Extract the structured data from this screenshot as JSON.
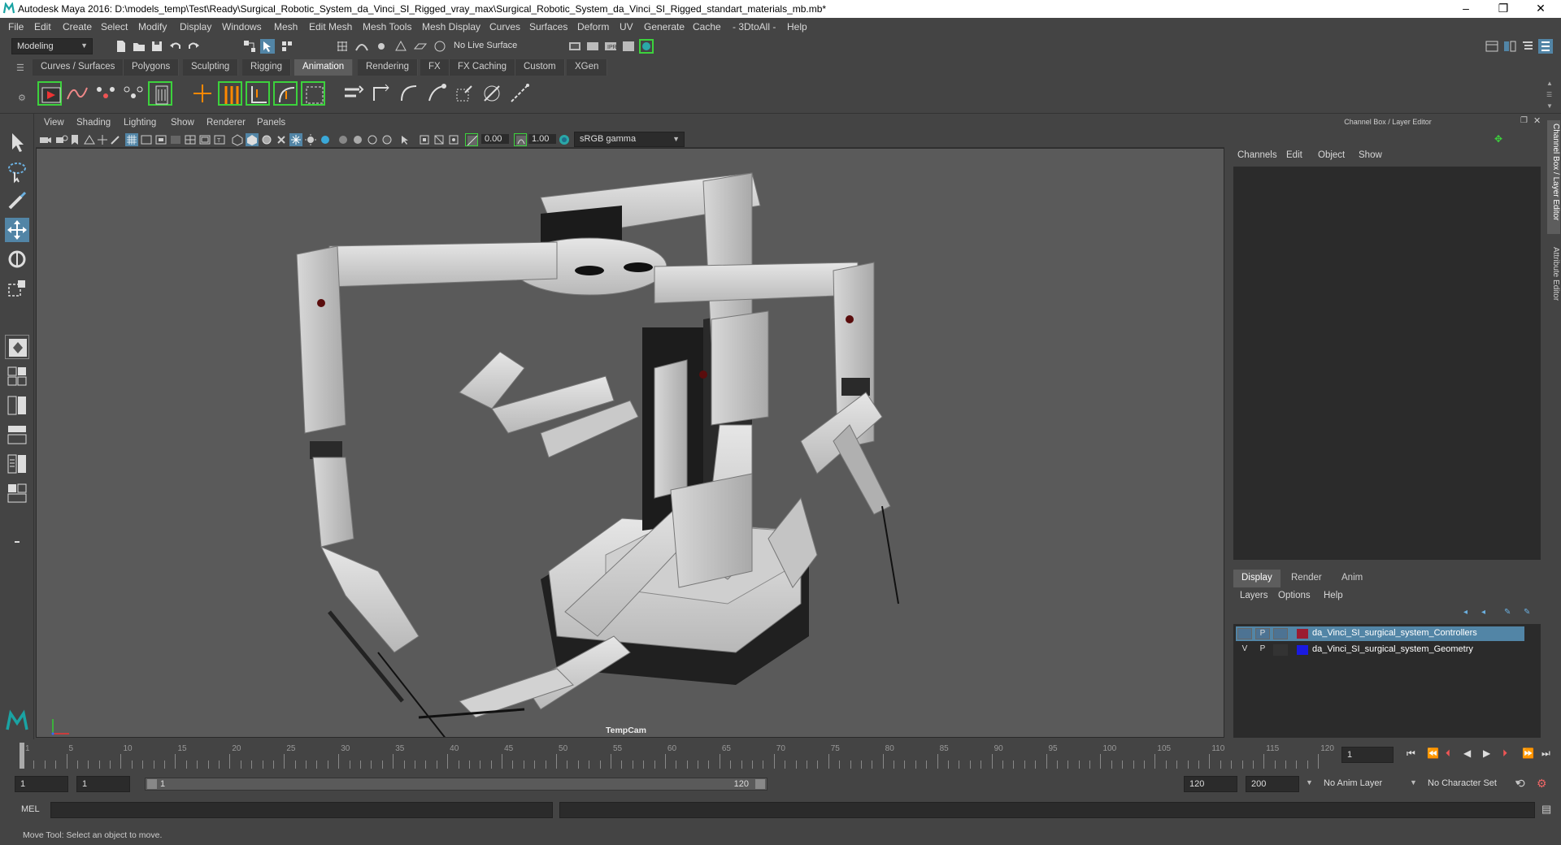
{
  "window": {
    "title": "Autodesk Maya 2016: D:\\models_temp\\Test\\Ready\\Surgical_Robotic_System_da_Vinci_SI_Rigged_vray_max\\Surgical_Robotic_System_da_Vinci_SI_Rigged_standart_materials_mb.mb*",
    "minimize": "–",
    "restore": "❐",
    "close": "✕"
  },
  "menubar": [
    "File",
    "Edit",
    "Create",
    "Select",
    "Modify",
    "Display",
    "Windows",
    "Mesh",
    "Edit Mesh",
    "Mesh Tools",
    "Mesh Display",
    "Curves",
    "Surfaces",
    "Deform",
    "UV",
    "Generate",
    "Cache",
    "- 3DtoAll -",
    "Help"
  ],
  "statusline": {
    "mode": "Modeling",
    "live_surface": "No Live Surface"
  },
  "shelf_tabs": [
    "Curves / Surfaces",
    "Polygons",
    "Sculpting",
    "Rigging",
    "Animation",
    "Rendering",
    "FX",
    "FX Caching",
    "Custom",
    "XGen"
  ],
  "active_shelf_tab": "Animation",
  "viewport": {
    "menu": [
      "View",
      "Shading",
      "Lighting",
      "Show",
      "Renderer",
      "Panels"
    ],
    "exposure": "0.00",
    "gamma": "1.00",
    "color_space": "sRGB gamma",
    "camera_label": "TempCam"
  },
  "channel_box": {
    "title": "Channel Box / Layer Editor",
    "menu": [
      "Channels",
      "Edit",
      "Object",
      "Show"
    ]
  },
  "layer_editor": {
    "tabs": [
      "Display",
      "Render",
      "Anim"
    ],
    "active_tab": "Display",
    "menu": [
      "Layers",
      "Options",
      "Help"
    ],
    "layers": [
      {
        "v": "",
        "p": "P",
        "name": "da_Vinci_SI_surgical_system_Controllers",
        "color": "#9b1c30",
        "selected": true
      },
      {
        "v": "V",
        "p": "P",
        "name": "da_Vinci_SI_surgical_system_Geometry",
        "color": "#1a1ae0",
        "selected": false
      }
    ]
  },
  "side_tabs": [
    "Channel Box / Layer Editor",
    "Attribute Editor"
  ],
  "timeline": {
    "ticks": [
      "1",
      "5",
      "10",
      "15",
      "20",
      "25",
      "30",
      "35",
      "40",
      "45",
      "50",
      "55",
      "60",
      "65",
      "70",
      "75",
      "80",
      "85",
      "90",
      "95",
      "100",
      "105",
      "110",
      "115",
      "120"
    ],
    "current_frame": "1"
  },
  "range": {
    "start": "1",
    "playback_start": "1",
    "slider_start": "1",
    "slider_end": "120",
    "playback_end": "120",
    "end": "200",
    "anim_layer": "No Anim Layer",
    "char_set": "No Character Set"
  },
  "command_line": {
    "label": "MEL"
  },
  "help_line": "Move Tool: Select an object to move."
}
